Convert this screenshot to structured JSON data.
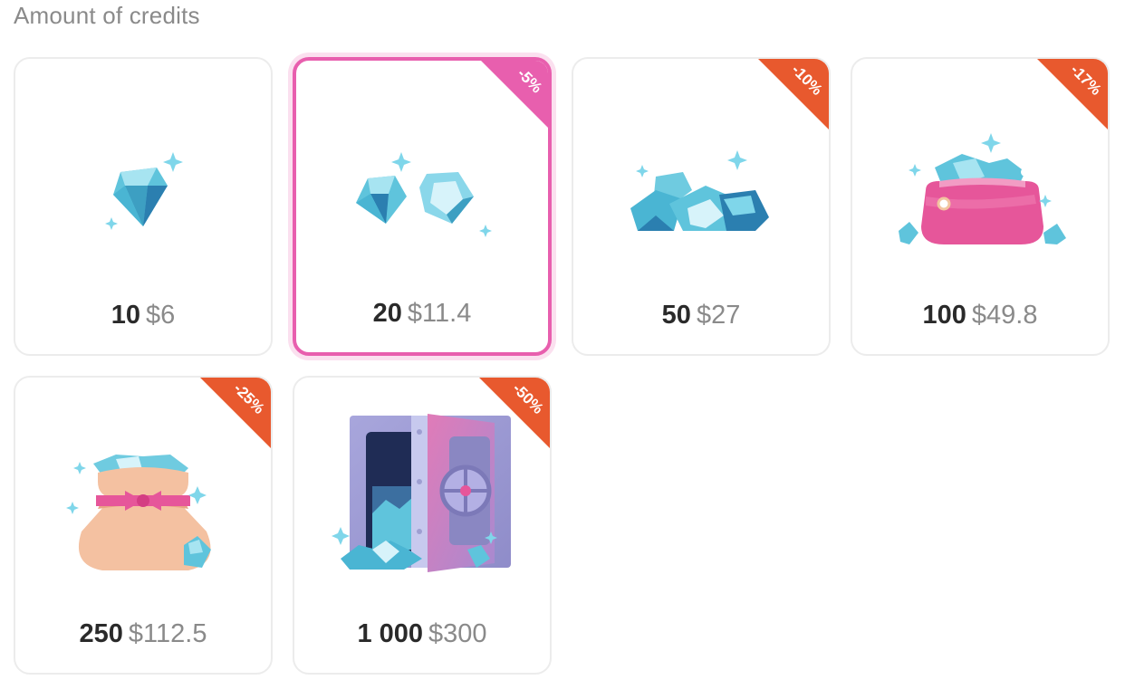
{
  "heading": "Amount of credits",
  "colors": {
    "selected_border": "#e85fae",
    "discount_badge": "#e8592e",
    "selected_badge": "#e85fae"
  },
  "packages": [
    {
      "quantity": "10",
      "price": "$6",
      "discount": "",
      "icon": "single-diamond-icon",
      "selected": false
    },
    {
      "quantity": "20",
      "price": "$11.4",
      "discount": "-5%",
      "icon": "two-diamonds-icon",
      "selected": true
    },
    {
      "quantity": "50",
      "price": "$27",
      "discount": "-10%",
      "icon": "diamond-pile-icon",
      "selected": false
    },
    {
      "quantity": "100",
      "price": "$49.8",
      "discount": "-17%",
      "icon": "purse-icon",
      "selected": false
    },
    {
      "quantity": "250",
      "price": "$112.5",
      "discount": "-25%",
      "icon": "sack-icon",
      "selected": false
    },
    {
      "quantity": "1 000",
      "price": "$300",
      "discount": "-50%",
      "icon": "safe-icon",
      "selected": false
    }
  ]
}
